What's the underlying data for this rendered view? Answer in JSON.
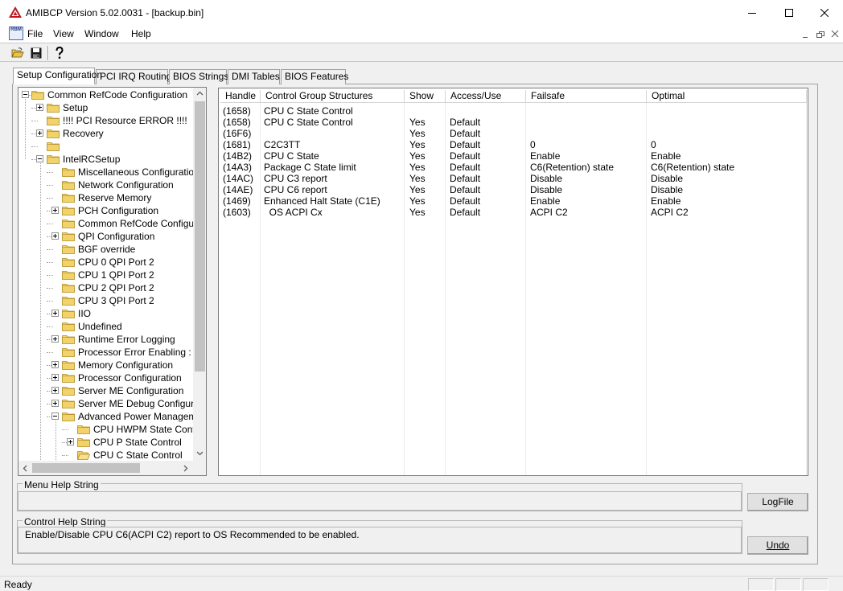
{
  "window": {
    "title": "AMIBCP Version 5.02.0031 - [backup.bin]"
  },
  "menu": {
    "items": [
      "File",
      "View",
      "Window",
      "Help"
    ],
    "app_icon_text": "RBM"
  },
  "tabs": [
    {
      "label": "Setup Configuration",
      "active": true
    },
    {
      "label": "PCI IRQ Routing",
      "active": false
    },
    {
      "label": "BIOS Strings",
      "active": false
    },
    {
      "label": "DMI Tables",
      "active": false
    },
    {
      "label": "BIOS Features",
      "active": false
    }
  ],
  "tree": {
    "nodes": [
      {
        "label": "Common RefCode Configuration",
        "depth": 0,
        "expander": "minus"
      },
      {
        "label": "Setup",
        "depth": 1,
        "expander": "plus"
      },
      {
        "label": "!!!! PCI Resource ERROR !!!!",
        "depth": 1,
        "expander": "none"
      },
      {
        "label": "Recovery",
        "depth": 1,
        "expander": "plus"
      },
      {
        "label": "",
        "depth": 1,
        "expander": "none"
      },
      {
        "label": "IntelRCSetup",
        "depth": 1,
        "expander": "minus"
      },
      {
        "label": "Miscellaneous Configuration",
        "depth": 2,
        "expander": "none"
      },
      {
        "label": "Network Configuration",
        "depth": 2,
        "expander": "none"
      },
      {
        "label": "Reserve Memory",
        "depth": 2,
        "expander": "none"
      },
      {
        "label": "PCH Configuration",
        "depth": 2,
        "expander": "plus"
      },
      {
        "label": "Common RefCode Configurati",
        "depth": 2,
        "expander": "none"
      },
      {
        "label": "QPI Configuration",
        "depth": 2,
        "expander": "plus"
      },
      {
        "label": "BGF override",
        "depth": 2,
        "expander": "none"
      },
      {
        "label": "CPU 0 QPI Port 2",
        "depth": 2,
        "expander": "none"
      },
      {
        "label": "CPU 1 QPI Port 2",
        "depth": 2,
        "expander": "none"
      },
      {
        "label": "CPU 2 QPI Port 2",
        "depth": 2,
        "expander": "none"
      },
      {
        "label": "CPU 3 QPI Port 2",
        "depth": 2,
        "expander": "none"
      },
      {
        "label": "IIO",
        "depth": 2,
        "expander": "plus"
      },
      {
        "label": "Undefined",
        "depth": 2,
        "expander": "none"
      },
      {
        "label": "Runtime Error Logging",
        "depth": 2,
        "expander": "plus"
      },
      {
        "label": "Processor Error Enabling :",
        "depth": 2,
        "expander": "none"
      },
      {
        "label": "Memory Configuration",
        "depth": 2,
        "expander": "plus"
      },
      {
        "label": "Processor Configuration",
        "depth": 2,
        "expander": "plus"
      },
      {
        "label": "Server ME Configuration",
        "depth": 2,
        "expander": "plus"
      },
      {
        "label": "Server ME Debug Configurati",
        "depth": 2,
        "expander": "plus"
      },
      {
        "label": "Advanced Power Manageme",
        "depth": 2,
        "expander": "minus"
      },
      {
        "label": "CPU HWPM State Contro",
        "depth": 3,
        "expander": "none"
      },
      {
        "label": "CPU P State Control",
        "depth": 3,
        "expander": "plus"
      },
      {
        "label": "CPU C State Control",
        "depth": 3,
        "expander": "none",
        "open_folder": true
      }
    ]
  },
  "grid": {
    "columns": [
      "Handle",
      "Control Group Structures",
      "Show",
      "Access/Use",
      "Failsafe",
      "Optimal"
    ],
    "rows": [
      [
        "(1658)",
        "CPU C State Control",
        "",
        "",
        "",
        ""
      ],
      [
        "(1658)",
        "CPU C State Control",
        "Yes",
        "Default",
        "",
        ""
      ],
      [
        "(16F6)",
        "",
        "Yes",
        "Default",
        "",
        ""
      ],
      [
        "(1681)",
        "C2C3TT",
        "Yes",
        "Default",
        "0",
        "0"
      ],
      [
        "(14B2)",
        "CPU C State",
        "Yes",
        "Default",
        "Enable",
        "Enable"
      ],
      [
        "(14A3)",
        "Package C State limit",
        "Yes",
        "Default",
        "C6(Retention) state",
        "C6(Retention) state"
      ],
      [
        "(14AC)",
        "CPU C3 report",
        "Yes",
        "Default",
        "Disable",
        "Disable"
      ],
      [
        "(14AE)",
        "CPU C6 report",
        "Yes",
        "Default",
        "Disable",
        "Disable"
      ],
      [
        "(1469)",
        "Enhanced Halt State (C1E)",
        "Yes",
        "Default",
        "Enable",
        "Enable"
      ],
      [
        "(1603)",
        "  OS ACPI Cx",
        "Yes",
        "Default",
        "ACPI C2",
        "ACPI C2"
      ]
    ]
  },
  "menu_help": {
    "label": "Menu Help String",
    "text": ""
  },
  "control_help": {
    "label": "Control Help String",
    "text": "Enable/Disable CPU C6(ACPI C2) report to OS Recommended to be enabled."
  },
  "buttons": {
    "logfile": "LogFile",
    "undo": "Undo"
  },
  "status": {
    "text": "Ready"
  },
  "colors": {
    "folder": "#f2d36b",
    "folder_edge": "#b08a1f",
    "window_bg": "#f0f0f0"
  }
}
